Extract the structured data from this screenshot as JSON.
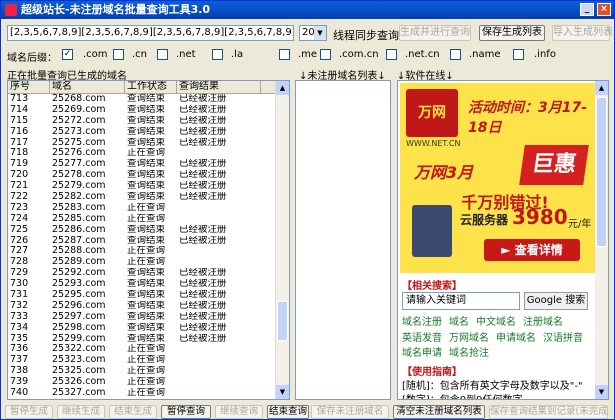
{
  "window": {
    "title": "超级站长-未注册域名批量查询工具3.0",
    "min_label": "_",
    "close_label": "×"
  },
  "toolbar": {
    "pattern_value": "[2,3,5,6,7,8,9][2,3,5,6,7,8,9][2,3,5,6,7,8,9][2,3,5,6,7,8,9][2,3,5,6,7,8,9]",
    "thread_count": "20",
    "thread_label": "线程同步查询",
    "start_label": "生成并进行查询",
    "save_list_label": "保存生成列表",
    "import_list_label": "导入生成列表"
  },
  "suffixes": {
    "label": "域名后缀：",
    "items": [
      {
        "name": ".com",
        "checked": true
      },
      {
        "name": ".cn",
        "checked": false
      },
      {
        "name": ".net",
        "checked": false
      },
      {
        "name": ".la",
        "checked": false
      },
      {
        "name": ".me",
        "checked": false
      },
      {
        "name": ".com.cn",
        "checked": false
      },
      {
        "name": ".net.cn",
        "checked": false
      },
      {
        "name": ".name",
        "checked": false
      },
      {
        "name": ".info",
        "checked": false
      }
    ]
  },
  "sections": {
    "querying": "正在批量查询已生成的域名",
    "unregistered": "↓未注册域名列表↓",
    "online": "↓软件在线↓"
  },
  "table": {
    "headers": [
      "序号",
      "域名",
      "工作状态",
      "查询结果"
    ],
    "rows": [
      [
        "713",
        "25268.com",
        "查询结束",
        "已经被注册"
      ],
      [
        "714",
        "25269.com",
        "查询结束",
        "已经被注册"
      ],
      [
        "715",
        "25272.com",
        "查询结束",
        "已经被注册"
      ],
      [
        "716",
        "25273.com",
        "查询结束",
        "已经被注册"
      ],
      [
        "717",
        "25275.com",
        "查询结束",
        "已经被注册"
      ],
      [
        "718",
        "25276.com",
        "正在查询",
        ""
      ],
      [
        "719",
        "25277.com",
        "查询结束",
        "已经被注册"
      ],
      [
        "720",
        "25278.com",
        "查询结束",
        "已经被注册"
      ],
      [
        "721",
        "25279.com",
        "查询结束",
        "已经被注册"
      ],
      [
        "722",
        "25282.com",
        "查询结束",
        "已经被注册"
      ],
      [
        "723",
        "25283.com",
        "正在查询",
        ""
      ],
      [
        "724",
        "25285.com",
        "正在查询",
        ""
      ],
      [
        "725",
        "25286.com",
        "查询结束",
        "已经被注册"
      ],
      [
        "726",
        "25287.com",
        "查询结束",
        "已经被注册"
      ],
      [
        "727",
        "25288.com",
        "正在查询",
        ""
      ],
      [
        "728",
        "25289.com",
        "正在查询",
        ""
      ],
      [
        "729",
        "25292.com",
        "查询结束",
        "已经被注册"
      ],
      [
        "730",
        "25293.com",
        "查询结束",
        "已经被注册"
      ],
      [
        "731",
        "25295.com",
        "查询结束",
        "已经被注册"
      ],
      [
        "732",
        "25296.com",
        "查询结束",
        "已经被注册"
      ],
      [
        "733",
        "25297.com",
        "查询结束",
        "已经被注册"
      ],
      [
        "734",
        "25298.com",
        "查询结束",
        "已经被注册"
      ],
      [
        "735",
        "25299.com",
        "查询结束",
        "已经被注册"
      ],
      [
        "736",
        "25322.com",
        "正在查询",
        ""
      ],
      [
        "737",
        "25323.com",
        "正在查询",
        ""
      ],
      [
        "738",
        "25325.com",
        "正在查询",
        ""
      ],
      [
        "739",
        "25326.com",
        "正在查询",
        ""
      ],
      [
        "740",
        "25327.com",
        "正在查询",
        ""
      ]
    ]
  },
  "ad": {
    "logo": "万网",
    "url": "WWW.NET.CN",
    "date": "活动时间：3月17-18日",
    "headline": "万网3月",
    "headline_big": "巨惠",
    "subline": "千万别错过!",
    "server_label": "云服务器",
    "price": "3980",
    "price_unit": "元/年",
    "detail_button": "► 查看详情"
  },
  "related": {
    "title": "【相关搜索】",
    "keyword_placeholder": "请输入关键词",
    "search_button": "Google 搜索",
    "links": [
      "域名注册",
      "域名",
      "中文域名",
      "注册域名",
      "英语发音",
      "万网域名",
      "申请域名",
      "汉语拼音",
      "域名申请",
      "域名抢注"
    ]
  },
  "guide": {
    "title": "【使用指南】",
    "line1": "[随机]：包含所有英文字母及数字以及\"-\"",
    "line2": "[数字]：包含0到9任何数字"
  },
  "bottom": {
    "buttons": [
      {
        "label": "暂停生成",
        "enabled": false
      },
      {
        "label": "继续生成",
        "enabled": false
      },
      {
        "label": "结束生成",
        "enabled": false
      },
      {
        "label": "暂停查询",
        "enabled": true
      },
      {
        "label": "继续查询",
        "enabled": false
      },
      {
        "label": "结束查询",
        "enabled": true
      },
      {
        "label": "保存未注册域名",
        "enabled": false
      },
      {
        "label": "清空未注册域名列表",
        "enabled": true
      },
      {
        "label": "保存查询结果到记录(未完成)",
        "enabled": false
      }
    ]
  }
}
